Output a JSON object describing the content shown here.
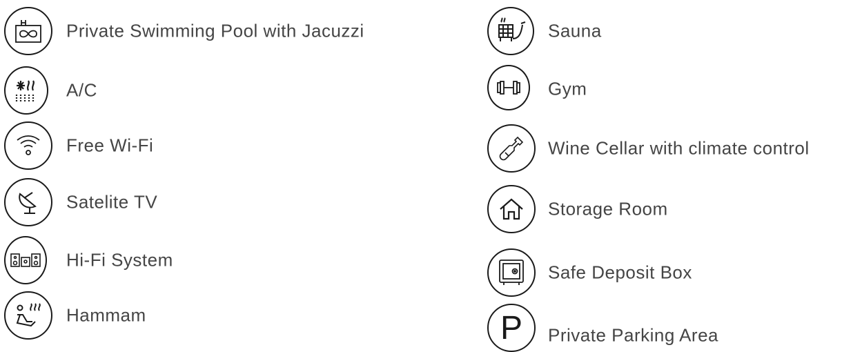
{
  "amenities": {
    "left": [
      {
        "label": "Private Swimming Pool with Jacuzzi",
        "icon": "pool-icon"
      },
      {
        "label": "A/C",
        "icon": "air-conditioning-icon"
      },
      {
        "label": "Free Wi-Fi",
        "icon": "wifi-icon"
      },
      {
        "label": "Satelite TV",
        "icon": "satellite-dish-icon"
      },
      {
        "label": "Hi-Fi System",
        "icon": "speakers-icon"
      },
      {
        "label": "Hammam",
        "icon": "hammam-icon"
      }
    ],
    "right": [
      {
        "label": "Sauna",
        "icon": "sauna-icon"
      },
      {
        "label": "Gym",
        "icon": "dumbbell-icon"
      },
      {
        "label": "Wine Cellar with climate control",
        "icon": "wine-bottle-icon"
      },
      {
        "label": "Storage Room",
        "icon": "house-icon"
      },
      {
        "label": "Safe Deposit Box",
        "icon": "safe-icon"
      },
      {
        "label": "Private Parking Area",
        "icon": "parking-icon",
        "glyph": "P"
      }
    ]
  },
  "colors": {
    "text": "#454545",
    "icon_stroke": "#1a1a1a",
    "background": "#ffffff"
  }
}
